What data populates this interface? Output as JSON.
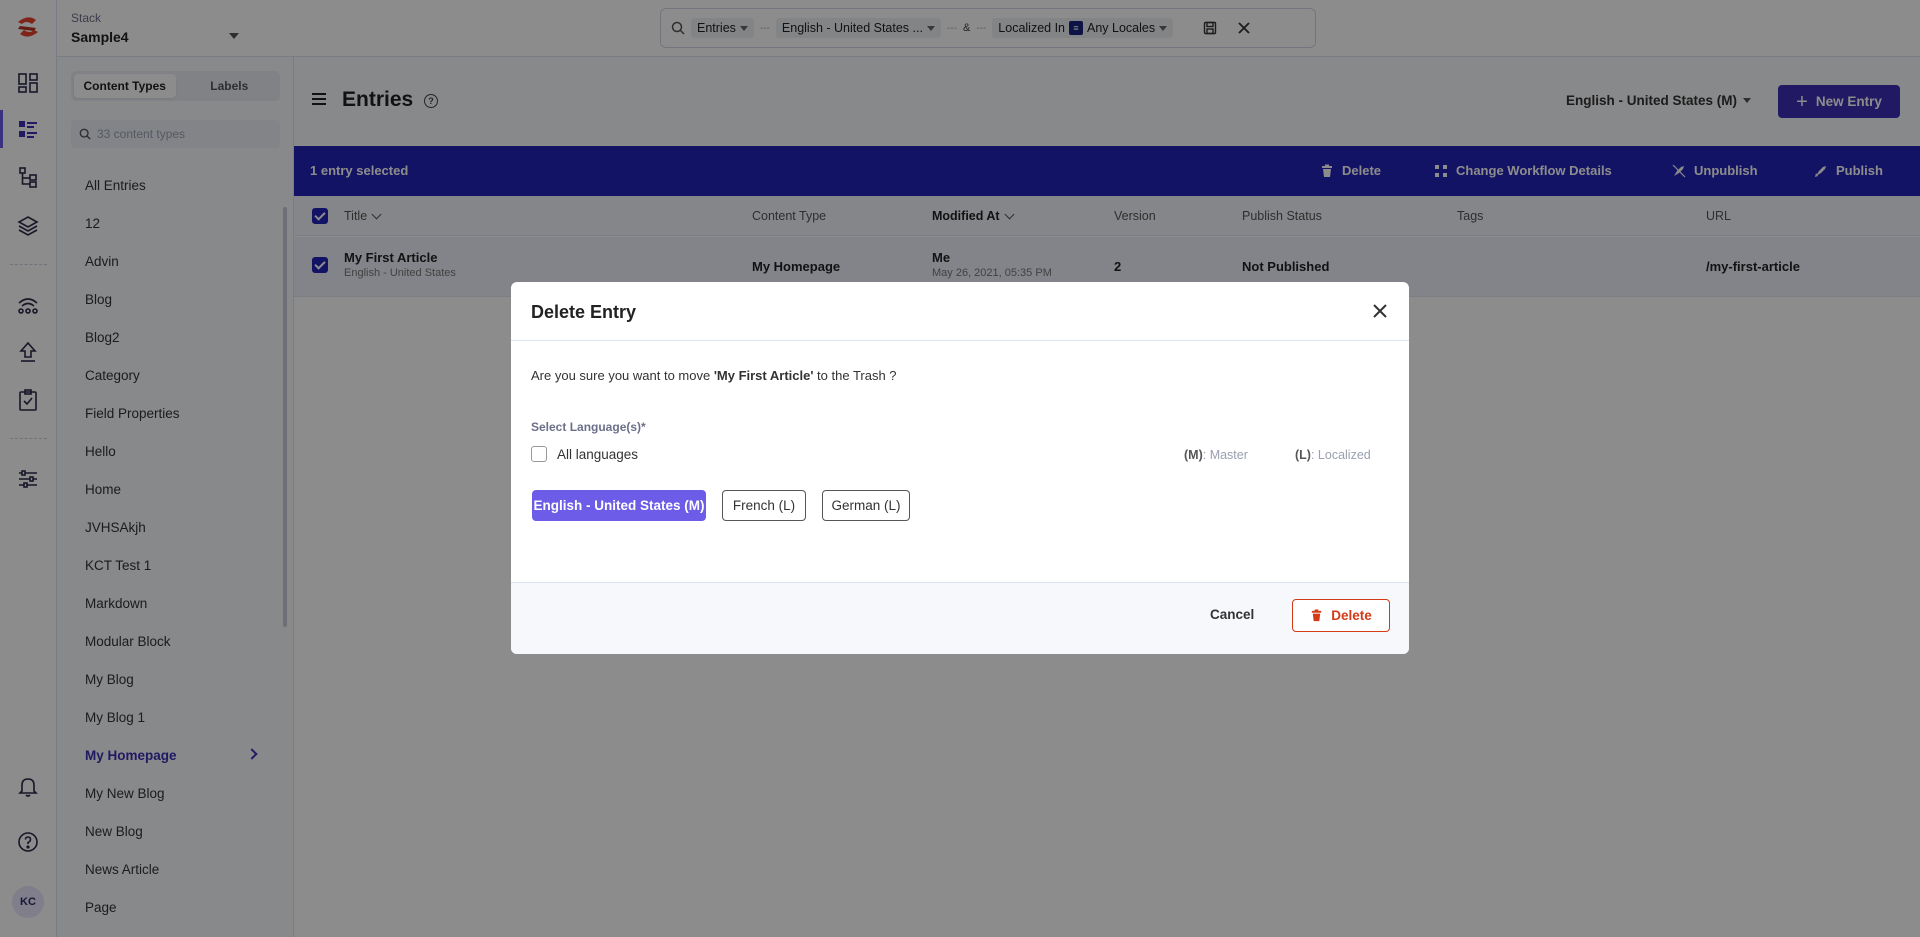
{
  "topbar": {
    "stack_label": "Stack",
    "stack_name": "Sample4",
    "search_chips": {
      "entries": "Entries",
      "locale": "English - United States ...",
      "amp": "&",
      "localized_in": "Localized In",
      "localized_badge": "≡",
      "any_locales": "Any Locales"
    }
  },
  "rail": {
    "avatar_initials": "KC"
  },
  "sidebar": {
    "tabs": [
      "Content Types",
      "Labels"
    ],
    "search_placeholder": "33 content types",
    "items": [
      "All Entries",
      "12",
      "Advin",
      "Blog",
      "Blog2",
      "Category",
      "Field Properties",
      "Hello",
      "Home",
      "JVHSAkjh",
      "KCT Test 1",
      "Markdown",
      "Modular Block",
      "My Blog",
      "My Blog 1",
      "My Homepage",
      "My New Blog",
      "New Blog",
      "News Article",
      "Page"
    ],
    "active_item": "My Homepage"
  },
  "header": {
    "title": "Entries",
    "language": "English - United States (M)",
    "new_entry_label": "New Entry"
  },
  "bulk": {
    "count_label": "1 entry selected",
    "delete": "Delete",
    "workflow": "Change Workflow Details",
    "unpublish": "Unpublish",
    "publish": "Publish"
  },
  "table": {
    "columns": [
      "Title",
      "Content Type",
      "Modified At",
      "Version",
      "Publish Status",
      "Tags",
      "URL"
    ],
    "row": {
      "title": "My First Article",
      "locale": "English - United States",
      "content_type": "My Homepage",
      "modified_by": "Me",
      "modified_at": "May 26, 2021, 05:35 PM",
      "version": "2",
      "status": "Not Published",
      "tags": "",
      "url": "/my-first-article"
    }
  },
  "modal": {
    "title": "Delete Entry",
    "msg_prefix": "Are you sure you want to move ",
    "msg_entry": "'My First Article'",
    "msg_suffix": " to the Trash ?",
    "select_label": "Select Language(s)*",
    "all_languages": "All languages",
    "legend_master_key": "(M)",
    "legend_master": ": Master",
    "legend_local_key": "(L)",
    "legend_local": ": Localized",
    "languages": [
      "English - United States (M)",
      "French (L)",
      "German (L)"
    ],
    "cancel": "Cancel",
    "delete": "Delete"
  },
  "colors": {
    "brand": "#3d2fb5",
    "bulk_bar": "#2424b8",
    "selected_lang": "#6c5ce7",
    "danger": "#d33a16"
  }
}
